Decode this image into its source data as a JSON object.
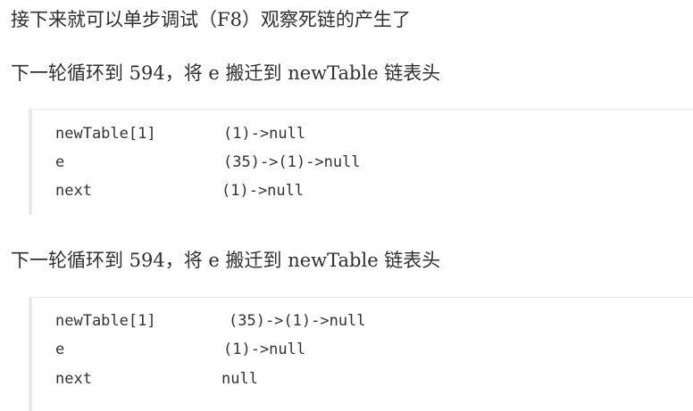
{
  "intro": "接下来就可以单步调试（F8）观察死链的产生了",
  "sections": [
    {
      "heading": "下一轮循环到 594，将 e 搬迁到 newTable 链表头",
      "rows": [
        {
          "name": "newTable[1]",
          "value": "(1)->null"
        },
        {
          "name": "e",
          "value": "(35)->(1)->null"
        },
        {
          "name": "next",
          "value": "(1)->null"
        }
      ]
    },
    {
      "heading": "下一轮循环到 594，将 e 搬迁到 newTable 链表头",
      "rows": [
        {
          "name": "newTable[1]",
          "value": "(35)->(1)->null"
        },
        {
          "name": "e",
          "value": "(1)->null"
        },
        {
          "name": "next",
          "value": "null"
        }
      ]
    }
  ]
}
